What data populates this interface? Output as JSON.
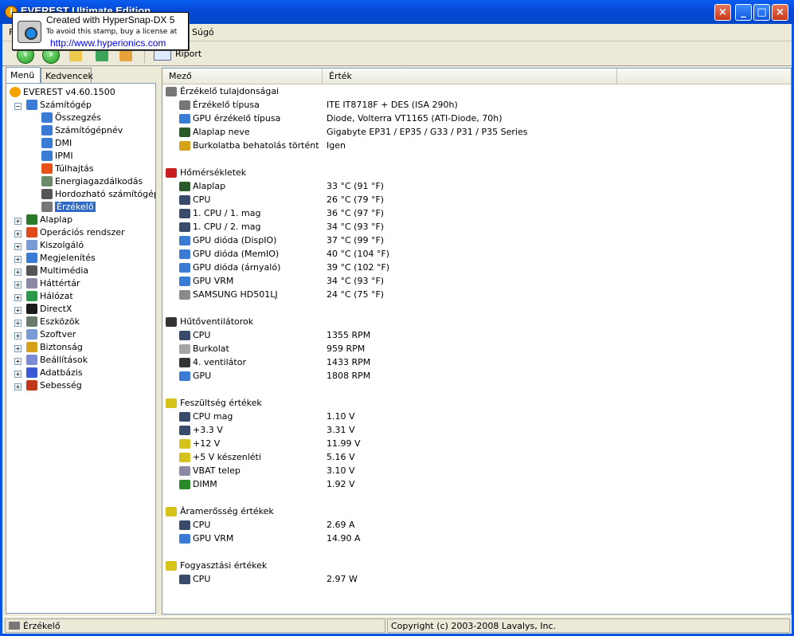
{
  "window": {
    "title": "EVEREST Ultimate Edition"
  },
  "stamp": {
    "line1": "Created with HyperSnap-DX 5",
    "line2": "To avoid this stamp, buy a license at",
    "line3": "http://www.hyperionics.com"
  },
  "menu": {
    "items": [
      "F",
      "Súgó"
    ]
  },
  "toolbar": {
    "report_label": "Riport"
  },
  "tabs": [
    "Menü",
    "Kedvencek"
  ],
  "tree": [
    {
      "label": "EVEREST v4.60.1500",
      "level": 0,
      "expander": "",
      "icon_color": "#f3a200",
      "icon": "info-icon"
    },
    {
      "label": "Számítógép",
      "level": 1,
      "expander": "−",
      "icon_color": "#3a7bd5",
      "icon": "computer-icon"
    },
    {
      "label": "Összegzés",
      "level": 2,
      "expander": "",
      "icon_color": "#3a7bd5",
      "icon": "computer-icon"
    },
    {
      "label": "Számítógépnév",
      "level": 2,
      "expander": "",
      "icon_color": "#3a7bd5",
      "icon": "computer-icon"
    },
    {
      "label": "DMI",
      "level": 2,
      "expander": "",
      "icon_color": "#3a7bd5",
      "icon": "computer-icon"
    },
    {
      "label": "IPMI",
      "level": 2,
      "expander": "",
      "icon_color": "#3a7bd5",
      "icon": "computer-icon"
    },
    {
      "label": "Túlhajtás",
      "level": 2,
      "expander": "",
      "icon_color": "#e8501a",
      "icon": "flame-icon"
    },
    {
      "label": "Energiagazdálkodás",
      "level": 2,
      "expander": "",
      "icon_color": "#6a8a6a",
      "icon": "power-icon"
    },
    {
      "label": "Hordozható számítógép",
      "level": 2,
      "expander": "",
      "icon_color": "#555555",
      "icon": "laptop-icon"
    },
    {
      "label": "Érzékelő",
      "level": 2,
      "expander": "",
      "icon_color": "#777777",
      "icon": "sensor-icon",
      "selected": true
    },
    {
      "label": "Alaplap",
      "level": 1,
      "expander": "+",
      "icon_color": "#2a7a2a",
      "icon": "motherboard-icon"
    },
    {
      "label": "Operációs rendszer",
      "level": 1,
      "expander": "+",
      "icon_color": "#e04a1a",
      "icon": "windows-icon"
    },
    {
      "label": "Kiszolgáló",
      "level": 1,
      "expander": "+",
      "icon_color": "#7a9ad5",
      "icon": "server-icon"
    },
    {
      "label": "Megjelenítés",
      "level": 1,
      "expander": "+",
      "icon_color": "#3a7bd5",
      "icon": "display-icon"
    },
    {
      "label": "Multimédia",
      "level": 1,
      "expander": "+",
      "icon_color": "#555555",
      "icon": "multimedia-icon"
    },
    {
      "label": "Háttértár",
      "level": 1,
      "expander": "+",
      "icon_color": "#8a8aa5",
      "icon": "storage-icon"
    },
    {
      "label": "Hálózat",
      "level": 1,
      "expander": "+",
      "icon_color": "#2a9a4a",
      "icon": "network-icon"
    },
    {
      "label": "DirectX",
      "level": 1,
      "expander": "+",
      "icon_color": "#1a1a1a",
      "icon": "directx-icon"
    },
    {
      "label": "Eszközök",
      "level": 1,
      "expander": "+",
      "icon_color": "#6a7a6a",
      "icon": "devices-icon"
    },
    {
      "label": "Szoftver",
      "level": 1,
      "expander": "+",
      "icon_color": "#7a9ad5",
      "icon": "software-icon"
    },
    {
      "label": "Biztonság",
      "level": 1,
      "expander": "+",
      "icon_color": "#d5a21a",
      "icon": "security-icon"
    },
    {
      "label": "Beállítások",
      "level": 1,
      "expander": "+",
      "icon_color": "#7a8ad5",
      "icon": "settings-icon"
    },
    {
      "label": "Adatbázis",
      "level": 1,
      "expander": "+",
      "icon_color": "#3a5ad5",
      "icon": "database-icon"
    },
    {
      "label": "Sebesség",
      "level": 1,
      "expander": "+",
      "icon_color": "#c03a1a",
      "icon": "benchmark-icon"
    }
  ],
  "columns": {
    "field": "Mező",
    "value": "Érték"
  },
  "sections": [
    {
      "title": "Érzékelő tulajdonságai",
      "icon": "sensor-icon",
      "icon_color": "#777777",
      "rows": [
        {
          "name": "Érzékelő típusa",
          "value": "ITE IT8718F + DES  (ISA 290h)",
          "icon": "sensor-icon",
          "icon_color": "#777777"
        },
        {
          "name": "GPU érzékelő típusa",
          "value": "Diode, Volterra VT1165  (ATI-Diode, 70h)",
          "icon": "gpu-icon",
          "icon_color": "#3a7bd5"
        },
        {
          "name": "Alaplap neve",
          "value": "Gigabyte EP31 / EP35 / G33 / P31 / P35 Series",
          "icon": "motherboard-icon",
          "icon_color": "#2a5a2a"
        },
        {
          "name": "Burkolatba behatolás történt",
          "value": "Igen",
          "icon": "lock-icon",
          "icon_color": "#d5a21a"
        }
      ]
    },
    {
      "title": "Hőmérsékletek",
      "icon": "thermometer-icon",
      "icon_color": "#c82020",
      "rows": [
        {
          "name": "Alaplap",
          "value": "33 °C  (91 °F)",
          "icon": "motherboard-icon",
          "icon_color": "#2a5a2a"
        },
        {
          "name": "CPU",
          "value": "26 °C  (79 °F)",
          "icon": "cpu-icon",
          "icon_color": "#3a4a6a"
        },
        {
          "name": "1. CPU / 1. mag",
          "value": "36 °C  (97 °F)",
          "icon": "cpu-icon",
          "icon_color": "#3a4a6a"
        },
        {
          "name": "1. CPU / 2. mag",
          "value": "34 °C  (93 °F)",
          "icon": "cpu-icon",
          "icon_color": "#3a4a6a"
        },
        {
          "name": "GPU dióda (DispIO)",
          "value": "37 °C  (99 °F)",
          "icon": "gpu-icon",
          "icon_color": "#3a7bd5"
        },
        {
          "name": "GPU dióda (MemIO)",
          "value": "40 °C  (104 °F)",
          "icon": "gpu-icon",
          "icon_color": "#3a7bd5"
        },
        {
          "name": "GPU dióda (árnyaló)",
          "value": "39 °C  (102 °F)",
          "icon": "gpu-icon",
          "icon_color": "#3a7bd5"
        },
        {
          "name": "GPU VRM",
          "value": "34 °C  (93 °F)",
          "icon": "gpu-icon",
          "icon_color": "#3a7bd5"
        },
        {
          "name": "SAMSUNG HD501LJ",
          "value": "24 °C  (75 °F)",
          "icon": "hdd-icon",
          "icon_color": "#8a8a8a"
        }
      ]
    },
    {
      "title": "Hűtőventilátorok",
      "icon": "fan-icon",
      "icon_color": "#333333",
      "rows": [
        {
          "name": "CPU",
          "value": "1355 RPM",
          "icon": "cpu-icon",
          "icon_color": "#3a4a6a"
        },
        {
          "name": "Burkolat",
          "value": "959 RPM",
          "icon": "case-icon",
          "icon_color": "#a5a5a5"
        },
        {
          "name": "4. ventilátor",
          "value": "1433 RPM",
          "icon": "fan-icon",
          "icon_color": "#333333"
        },
        {
          "name": "GPU",
          "value": "1808 RPM",
          "icon": "gpu-icon",
          "icon_color": "#3a7bd5"
        }
      ]
    },
    {
      "title": "Feszültség értékek",
      "icon": "voltage-icon",
      "icon_color": "#d5c21a",
      "rows": [
        {
          "name": "CPU mag",
          "value": "1.10 V",
          "icon": "cpu-icon",
          "icon_color": "#3a4a6a"
        },
        {
          "name": "+3.3 V",
          "value": "3.31 V",
          "icon": "cpu-icon",
          "icon_color": "#3a4a6a"
        },
        {
          "name": "+12 V",
          "value": "11.99 V",
          "icon": "voltage-icon",
          "icon_color": "#d5c21a"
        },
        {
          "name": "+5 V készenléti",
          "value": "5.16 V",
          "icon": "voltage-icon",
          "icon_color": "#d5c21a"
        },
        {
          "name": "VBAT telep",
          "value": "3.10 V",
          "icon": "battery-icon",
          "icon_color": "#8a8aa5"
        },
        {
          "name": "DIMM",
          "value": "1.92 V",
          "icon": "memory-icon",
          "icon_color": "#2a8a2a"
        }
      ]
    },
    {
      "title": "Áramerősség értékek",
      "icon": "voltage-icon",
      "icon_color": "#d5c21a",
      "rows": [
        {
          "name": "CPU",
          "value": "2.69 A",
          "icon": "cpu-icon",
          "icon_color": "#3a4a6a"
        },
        {
          "name": "GPU VRM",
          "value": "14.90 A",
          "icon": "gpu-icon",
          "icon_color": "#3a7bd5"
        }
      ]
    },
    {
      "title": "Fogyasztási értékek",
      "icon": "voltage-icon",
      "icon_color": "#d5c21a",
      "rows": [
        {
          "name": "CPU",
          "value": "2.97 W",
          "icon": "cpu-icon",
          "icon_color": "#3a4a6a"
        }
      ]
    }
  ],
  "status": {
    "left": "Érzékelő",
    "right": "Copyright (c) 2003-2008 Lavalys, Inc."
  }
}
